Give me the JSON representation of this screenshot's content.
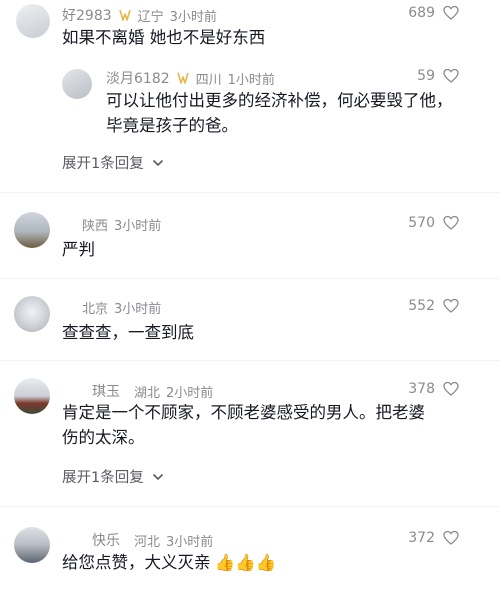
{
  "colors": {
    "text": "#161823",
    "meta": "#8a8b91",
    "badge": "#e7b74c",
    "divider": "#f2f2f4"
  },
  "comments": [
    {
      "user": "好2983",
      "location": "辽宁",
      "time": "3小时前",
      "text": [
        "如果不离婚  她也不是好东西"
      ],
      "likes": "689",
      "has_badge": true
    },
    {
      "user": "淡月6182",
      "location": "四川",
      "time": "1小时前",
      "text": [
        "可以让他付出更多的经济补偿，何必要毁了他，",
        "毕竟是孩子的爸。"
      ],
      "likes": "59",
      "has_badge": true
    },
    {
      "user": "",
      "location": "陕西",
      "time": "3小时前",
      "text": [
        "严判"
      ],
      "likes": "570",
      "has_badge": false
    },
    {
      "user": "",
      "location": "北京",
      "time": "3小时前",
      "text": [
        "查查查，一查到底"
      ],
      "likes": "552",
      "has_badge": false
    },
    {
      "user": "琪玉",
      "location": "湖北",
      "time": "2小时前",
      "text": [
        "肯定是一个不顾家，不顾老婆感受的男人。把老婆",
        "伤的太深。"
      ],
      "likes": "378",
      "has_badge": false
    },
    {
      "user": "快乐",
      "location": "河北",
      "time": "3小时前",
      "text": [
        "给您点赞，大义灭亲"
      ],
      "likes": "372",
      "has_badge": false,
      "emoji": "👍👍👍"
    }
  ],
  "expand_label": "展开1条回复"
}
